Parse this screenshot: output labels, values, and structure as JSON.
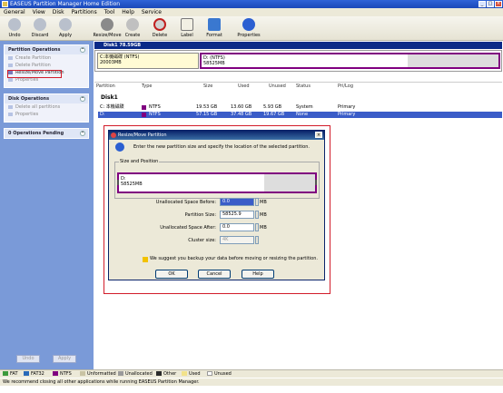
{
  "window": {
    "title": "EASEUS Partition Manager Home Edition"
  },
  "menu": [
    "General",
    "View",
    "Disk",
    "Partitions",
    "Tool",
    "Help",
    "Service"
  ],
  "toolbar": {
    "undo": "Undo",
    "discard": "Discard",
    "apply": "Apply",
    "resize": "Resize/Move",
    "create": "Create",
    "delete": "Delete",
    "label": "Label",
    "format": "Format",
    "properties": "Properties"
  },
  "leftpanel": {
    "partition_ops": {
      "title": "Partition Operations",
      "items": [
        "Create Partition",
        "Delete Partition",
        "Resize/Move Partition",
        "Properties"
      ]
    },
    "disk_ops": {
      "title": "Disk Operations",
      "items": [
        "Delete all partitions",
        "Properties"
      ]
    },
    "pending": {
      "title": "0 Operations Pending"
    },
    "undo_btn": "Undo",
    "apply_btn": "Apply"
  },
  "diskmap": {
    "header": "Disk1   78.59GB",
    "p1_name": "C:本機磁碟 (NTFS)",
    "p1_size": "20003MB",
    "p2_name": "D: (NTFS)",
    "p2_size": "58525MB"
  },
  "table": {
    "headers": [
      "Partition",
      "Type",
      "Size",
      "Used",
      "Unused",
      "Status",
      "Pri/Log"
    ],
    "disk_label": "Disk1",
    "rows": [
      {
        "partition": "C: 本機磁碟",
        "type": "NTFS",
        "size": "19.53 GB",
        "used": "13.60 GB",
        "unused": "5.93 GB",
        "status": "System",
        "prilog": "Primary"
      },
      {
        "partition": "D:",
        "type": "NTFS",
        "size": "57.15 GB",
        "used": "37.48 GB",
        "unused": "19.67 GB",
        "status": "None",
        "prilog": "Primary"
      }
    ]
  },
  "dialog": {
    "title": "Resize/Move Partition",
    "intro": "Enter the new partition size and specify the location of the selected partition.",
    "group_label": "Size and Position",
    "bar_name": "D:",
    "bar_size": "58525MB",
    "fields": {
      "before_label": "Unallocated Space Before:",
      "before_value": "0.0",
      "size_label": "Partition Size:",
      "size_value": "58525.9",
      "after_label": "Unallocated Space After:",
      "after_value": "0.0",
      "cluster_label": "Cluster size:",
      "cluster_value": "4K",
      "unit": "MB"
    },
    "warning": "We suggest you backup your data before moving or resizing the partition.",
    "ok": "OK",
    "cancel": "Cancel",
    "help": "Help"
  },
  "legend": [
    "FAT",
    "FAT32",
    "NTFS",
    "Unformatted",
    "Unallocated",
    "Other",
    "Used",
    "Unused"
  ],
  "legend_colors": [
    "#3c9a3c",
    "#2a6ab8",
    "#800080",
    "#c9c3a3",
    "#9a9a9a",
    "#2a2a2a",
    "#f2e28a",
    "#ffffff"
  ],
  "statusbar": "We recommend closing all other applications while running EASEUS Partition Manager."
}
